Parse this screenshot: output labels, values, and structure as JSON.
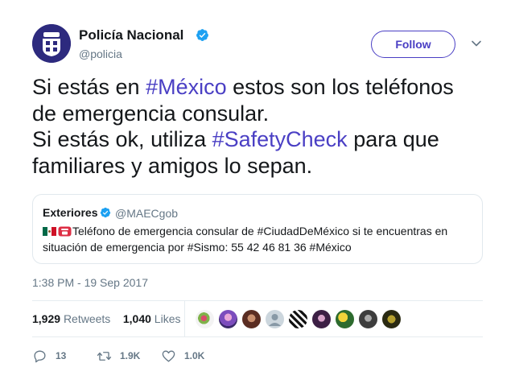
{
  "author": {
    "name": "Policía Nacional",
    "handle": "@policia"
  },
  "follow_button": {
    "label": "Follow"
  },
  "tweet": {
    "line1": {
      "text1": "Si estás en ",
      "hashtag1": "#México",
      "text2": " estos son los teléfonos"
    },
    "line2": {
      "text": "de emergencia consular."
    },
    "line3": {
      "text1": "Si estás ok, utiliza ",
      "hashtag": "#SafetyCheck",
      "text2": " para que"
    },
    "line4": {
      "text": "familiares y amigos lo sepan."
    }
  },
  "quoted_tweet": {
    "name": "Exteriores",
    "handle": "@MAECgob",
    "line1": "Teléfono de emergencia consular de #CiudadDeMéxico si te encuentras en",
    "line2": "situación de emergencia por #Sismo: 55 42 46 81 36 #México"
  },
  "timestamp": "1:38 PM - 19 Sep 2017",
  "stats": {
    "retweets_count": "1,929",
    "retweets_label": "Retweets",
    "likes_count": "1,040",
    "likes_label": "Likes"
  },
  "actions": {
    "reply_count": "13",
    "retweet_count": "1.9K",
    "like_count": "1.0K"
  },
  "colors": {
    "accent": "#4a3fc4",
    "verified": "#1da1f2",
    "secondary_text": "#657786"
  }
}
